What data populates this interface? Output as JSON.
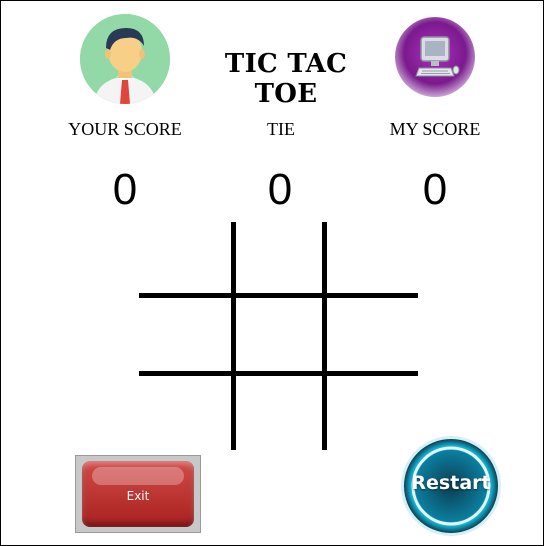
{
  "header": {
    "title": "TIC TAC TOE",
    "player_icon": "user-avatar-icon",
    "computer_icon": "computer-icon"
  },
  "scoreboard": {
    "player_label": "YOUR SCORE",
    "tie_label": "TIE",
    "computer_label": "MY SCORE",
    "player_score": "0",
    "tie_score": "0",
    "computer_score": "0"
  },
  "board": {
    "cells": [
      "",
      "",
      "",
      "",
      "",
      "",
      "",
      "",
      ""
    ]
  },
  "controls": {
    "exit_label": "Exit",
    "restart_label": "Restart"
  },
  "colors": {
    "player_avatar_bg": "#93d9a8",
    "computer_icon_bg": "#7a1a8c",
    "exit_button": "#b83432",
    "restart_button": "#0a8fb0"
  }
}
